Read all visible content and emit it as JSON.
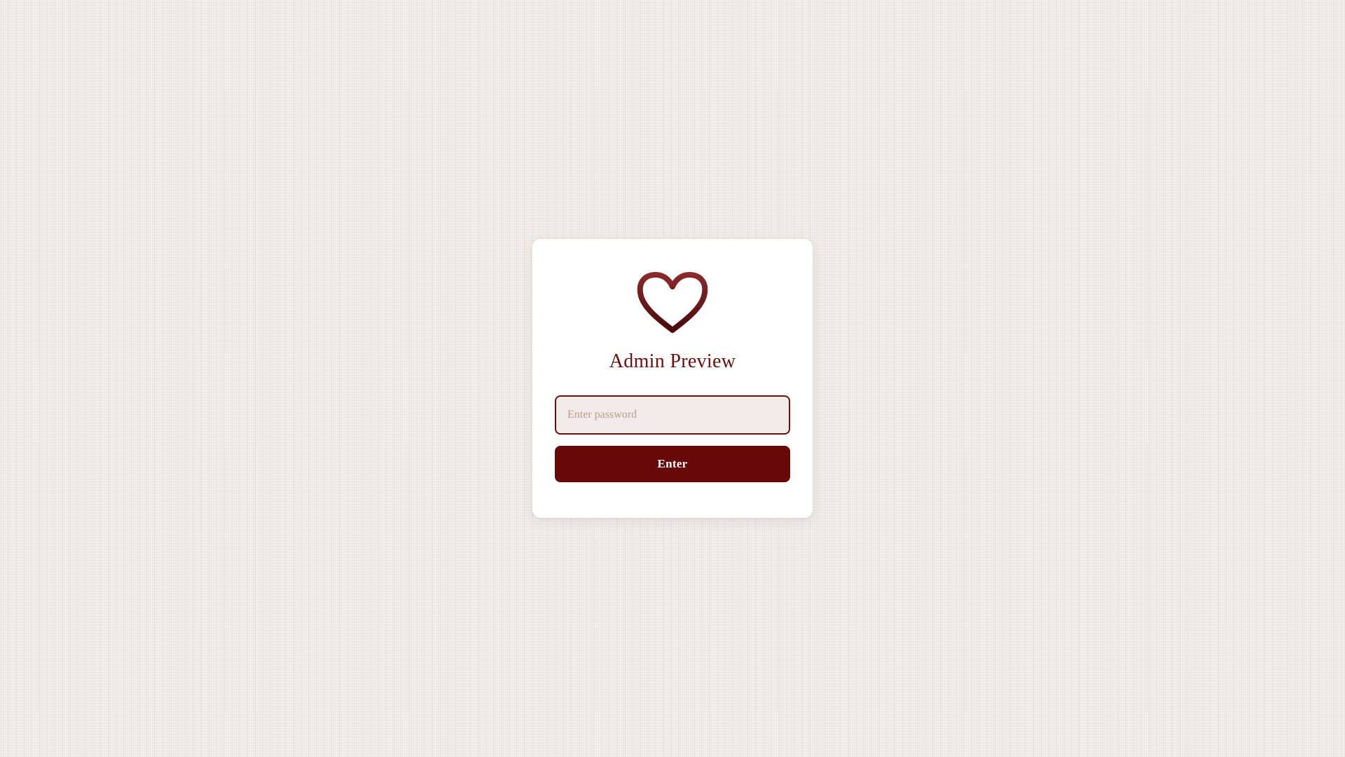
{
  "login": {
    "logo_icon": "heart-outline-icon",
    "title": "Admin Preview",
    "password": {
      "value": "",
      "placeholder": "Enter password"
    },
    "submit_label": "Enter"
  },
  "colors": {
    "accent": "#6b0e0e",
    "button": "#670909",
    "card": "#ffffff",
    "input_bg": "#f1ecea",
    "page_bg": "#efebe8"
  }
}
